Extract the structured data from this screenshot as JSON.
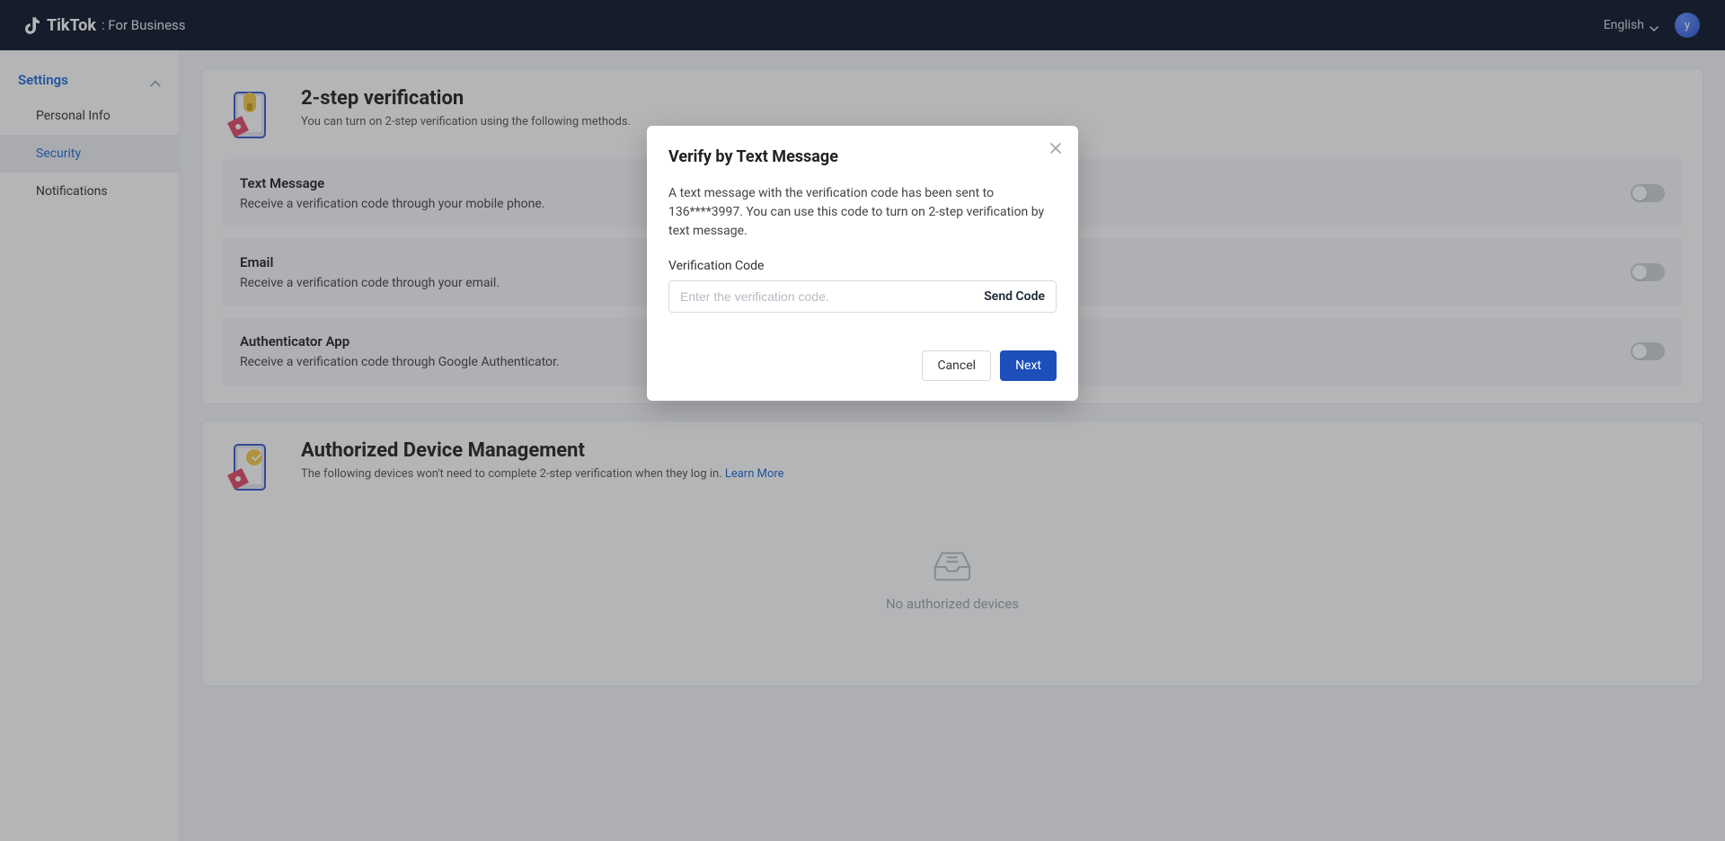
{
  "header": {
    "brand_main": "TikTok",
    "brand_sub": ": For Business",
    "language": "English",
    "avatar_initial": "y"
  },
  "sidebar": {
    "heading": "Settings",
    "items": [
      {
        "label": "Personal Info"
      },
      {
        "label": "Security"
      },
      {
        "label": "Notifications"
      }
    ]
  },
  "security": {
    "two_step": {
      "title": "2-step verification",
      "subtitle_prefix": "You can turn on 2-step verification using the following methods. ",
      "methods": [
        {
          "title": "Text Message",
          "desc": "Receive a verification code through your mobile phone."
        },
        {
          "title": "Email",
          "desc": "Receive a verification code through your email."
        },
        {
          "title": "Authenticator App",
          "desc": "Receive a verification code through Google Authenticator."
        }
      ]
    },
    "devices": {
      "title": "Authorized Device Management",
      "subtitle": "The following devices won't need to complete 2-step verification when they log in. ",
      "learn_more": "Learn More",
      "empty": "No authorized devices"
    }
  },
  "modal": {
    "title": "Verify by Text Message",
    "description": "A text message with the verification code has been sent to 136****3997. You can use this code to turn on 2-step verification by text message.",
    "field_label": "Verification Code",
    "placeholder": "Enter the verification code.",
    "send_code": "Send Code",
    "cancel": "Cancel",
    "next": "Next"
  }
}
